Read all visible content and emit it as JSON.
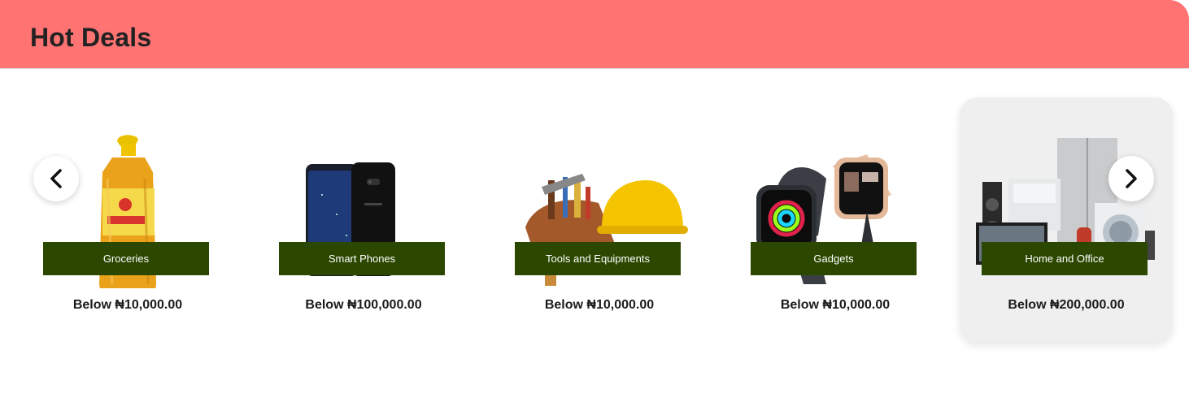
{
  "header": {
    "title": "Hot Deals",
    "background": "#ff7373"
  },
  "carousel": {
    "prev_icon": "chevron-left-icon",
    "next_icon": "chevron-right-icon",
    "label_color": "#2b4700",
    "items": [
      {
        "category": "Groceries",
        "price": "Below ₦10,000.00",
        "image": "cooking-oil-bottle"
      },
      {
        "category": "Smart Phones",
        "price": "Below ₦100,000.00",
        "image": "smartphone"
      },
      {
        "category": "Tools and Equipments",
        "price": "Below ₦10,000.00",
        "image": "tool-belt-and-hard-hat"
      },
      {
        "category": "Gadgets",
        "price": "Below ₦10,000.00",
        "image": "smart-watches"
      },
      {
        "category": "Home and Office",
        "price": "Below ₦200,000.00",
        "image": "home-appliances"
      }
    ]
  }
}
